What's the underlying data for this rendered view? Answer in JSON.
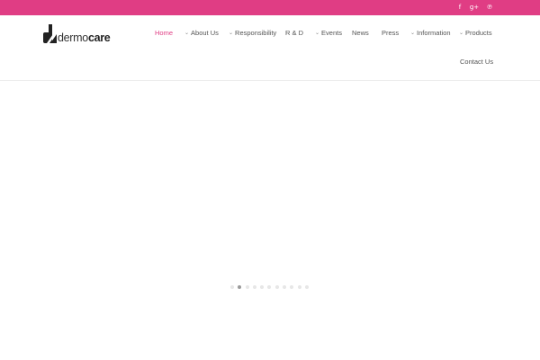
{
  "brand": {
    "logo_regular": "dermo",
    "logo_bold": "care",
    "accent_color": "#e03d84"
  },
  "social": [
    {
      "icon": "facebook-icon",
      "glyph": "f"
    },
    {
      "icon": "google-plus-icon",
      "glyph": "g+"
    },
    {
      "icon": "pinterest-icon",
      "glyph": "℗"
    }
  ],
  "nav": {
    "home": "Home",
    "about": "About Us",
    "responsibility": "Responsibility",
    "rnd": "R & D",
    "events": "Events",
    "news": "News",
    "press": "Press",
    "information": "Information",
    "products": "Products",
    "contact": "Contact Us"
  },
  "slider": {
    "slide_count": 11,
    "active_slide": 2
  }
}
